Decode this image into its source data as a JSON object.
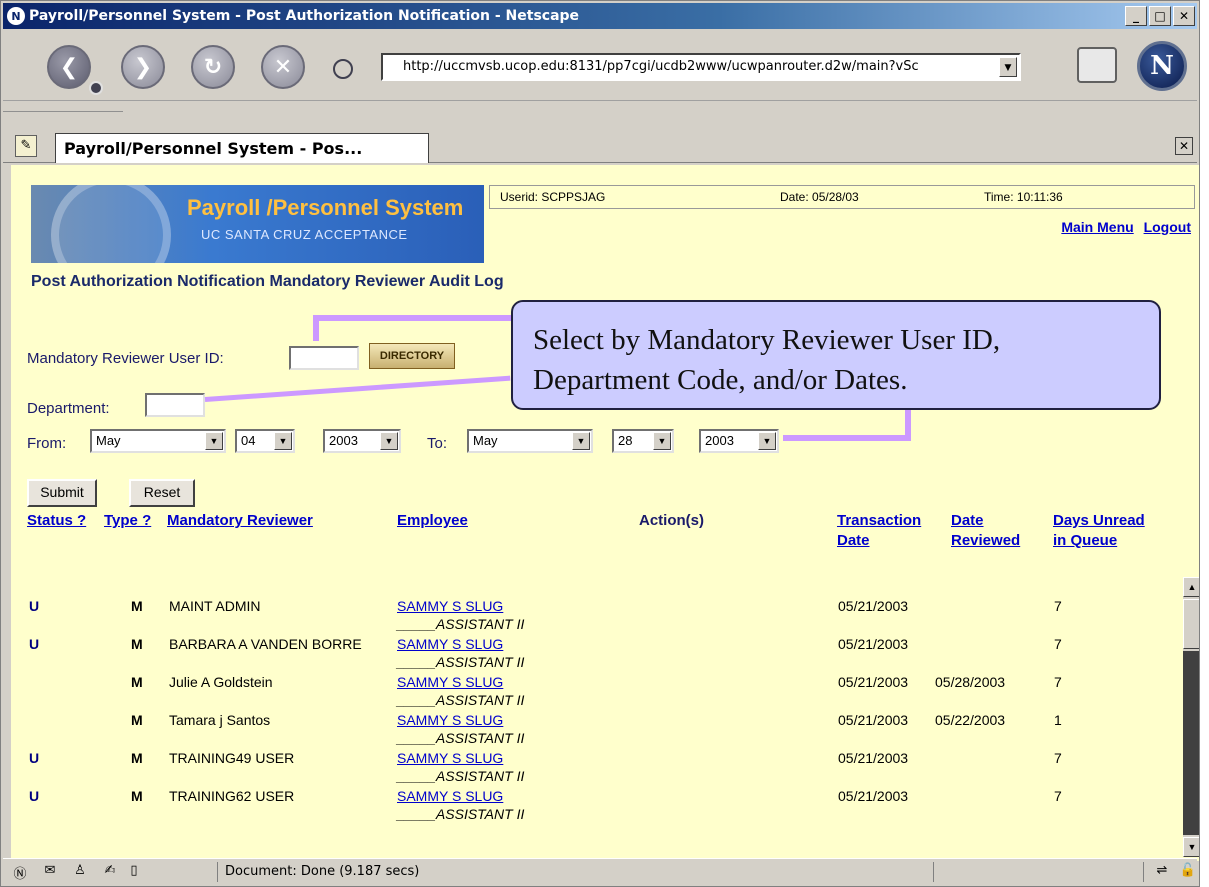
{
  "window": {
    "title": "Payroll/Personnel System - Post Authorization Notification - Netscape",
    "min_label": "_",
    "max_label": "□",
    "close_label": "✕"
  },
  "toolbar": {
    "url": "http://uccmvsb.ucop.edu:8131/pp7cgi/ucdb2www/ucwpanrouter.d2w/main?vSc",
    "back_icon": "back-arrow-icon",
    "forward_icon": "forward-arrow-icon",
    "reload_icon": "reload-icon",
    "stop_icon": "stop-icon"
  },
  "tab": {
    "label": "Payroll/Personnel System - Pos..."
  },
  "header": {
    "logo_title": "Payroll /Personnel System",
    "logo_subtitle": "UC SANTA CRUZ ACCEPTANCE",
    "userid": "Userid: SCPPSJAG",
    "date": "Date: 05/28/03",
    "time": "Time: 10:11:36",
    "main_menu": "Main Menu",
    "logout": "Logout"
  },
  "page": {
    "title": "Post Authorization Notification Mandatory Reviewer Audit Log"
  },
  "form": {
    "reviewer_label": "Mandatory Reviewer User ID:",
    "reviewer_value": "",
    "directory_button": "DIRECTORY",
    "department_label": "Department:",
    "department_value": "",
    "from_label": "From:",
    "to_label": "To:",
    "from_month": "May",
    "from_day": "04",
    "from_year": "2003",
    "to_month": "May",
    "to_day": "28",
    "to_year": "2003",
    "submit_label": "Submit",
    "reset_label": "Reset"
  },
  "callout": {
    "line1": "Select by Mandatory Reviewer User ID,",
    "line2": "Department Code, and/or Dates."
  },
  "table": {
    "headers": {
      "status": "Status ?",
      "type": "Type ?",
      "reviewer": "Mandatory Reviewer",
      "employee": "Employee",
      "actions": "Action(s)",
      "transaction_date_1": "Transaction",
      "transaction_date_2": "Date",
      "date_reviewed_1": "Date",
      "date_reviewed_2": "Reviewed",
      "days_unread_1": "Days Unread",
      "days_unread_2": "in Queue"
    },
    "rows": [
      {
        "status": "U",
        "type": "M",
        "reviewer": "MAINT ADMIN",
        "employee": "SAMMY S SLUG",
        "title": "_____ASSISTANT II",
        "transaction_date": "05/21/2003",
        "date_reviewed": "",
        "days_unread": "7"
      },
      {
        "status": "U",
        "type": "M",
        "reviewer": "BARBARA A VANDEN BORRE",
        "employee": "SAMMY S SLUG",
        "title": "_____ASSISTANT II",
        "transaction_date": "05/21/2003",
        "date_reviewed": "",
        "days_unread": "7"
      },
      {
        "status": "",
        "type": "M",
        "reviewer": "Julie A Goldstein",
        "employee": "SAMMY S SLUG",
        "title": "_____ASSISTANT II",
        "transaction_date": "05/21/2003",
        "date_reviewed": "05/28/2003",
        "days_unread": "7"
      },
      {
        "status": "",
        "type": "M",
        "reviewer": "Tamara j Santos",
        "employee": "SAMMY S SLUG",
        "title": "_____ASSISTANT II",
        "transaction_date": "05/21/2003",
        "date_reviewed": "05/22/2003",
        "days_unread": "1"
      },
      {
        "status": "U",
        "type": "M",
        "reviewer": "TRAINING49 USER",
        "employee": "SAMMY S SLUG",
        "title": "_____ASSISTANT II",
        "transaction_date": "05/21/2003",
        "date_reviewed": "",
        "days_unread": "7"
      },
      {
        "status": "U",
        "type": "M",
        "reviewer": "TRAINING62 USER",
        "employee": "SAMMY S SLUG",
        "title": "_____ASSISTANT II",
        "transaction_date": "05/21/2003",
        "date_reviewed": "",
        "days_unread": "7"
      }
    ]
  },
  "statusbar": {
    "message": "Document: Done (9.187 secs)"
  }
}
